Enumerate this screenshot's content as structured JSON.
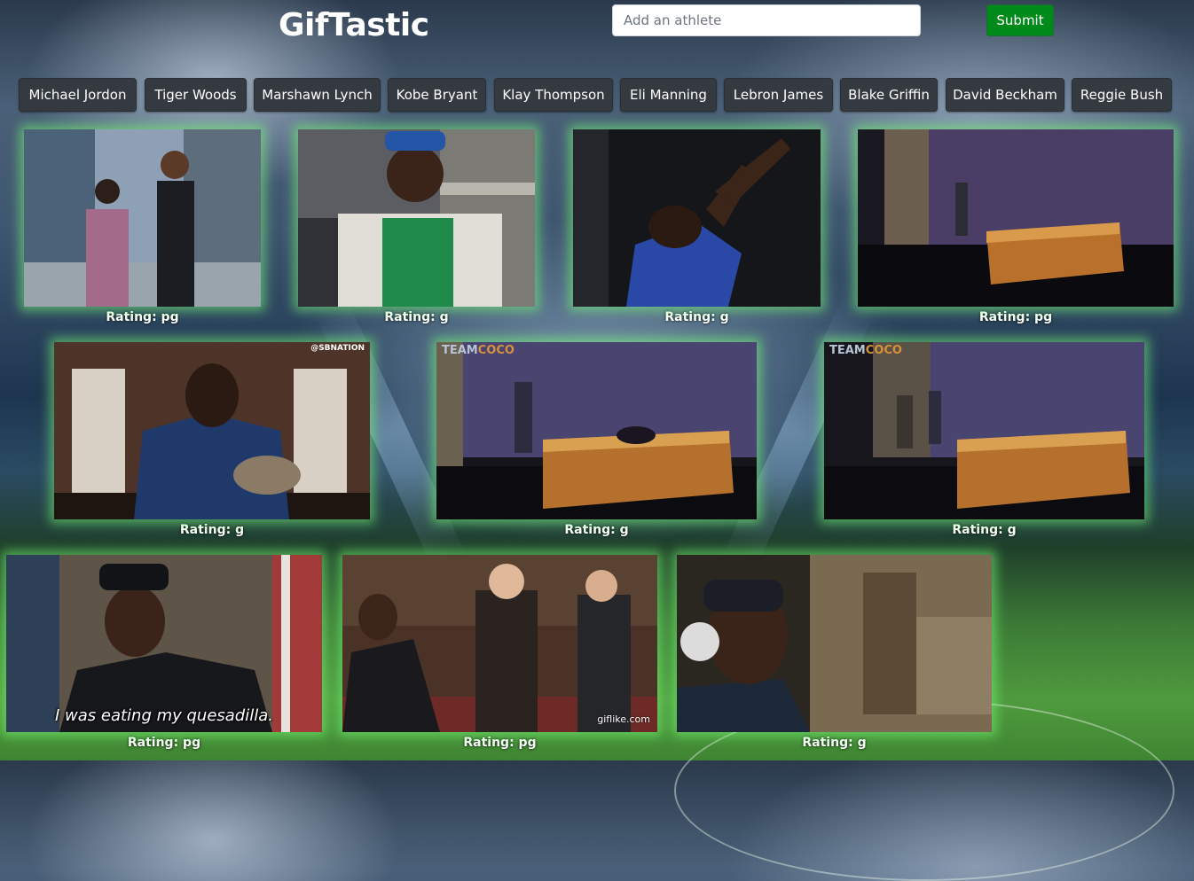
{
  "header": {
    "title": "GifTastic",
    "input_placeholder": "Add an athlete",
    "input_value": "",
    "submit_label": "Submit"
  },
  "athletes": [
    "Michael Jordon",
    "Tiger Woods",
    "Marshawn Lynch",
    "Kobe Bryant",
    "Klay Thompson",
    "Eli Manning",
    "Lebron James",
    "Blake Griffin",
    "David Beckham",
    "Reggie Bush"
  ],
  "gifs": [
    {
      "rating": "Rating: pg"
    },
    {
      "rating": "Rating: g"
    },
    {
      "rating": "Rating: g"
    },
    {
      "rating": "Rating: pg"
    },
    {
      "rating": "Rating: g",
      "logo": "@SBNATION"
    },
    {
      "rating": "Rating: g",
      "logo_a": "TEAM",
      "logo_b": "COCO"
    },
    {
      "rating": "Rating: g",
      "logo_a": "TEAM",
      "logo_b": "COCO"
    },
    {
      "rating": "Rating: pg",
      "caption": "I was eating my quesadilla."
    },
    {
      "rating": "Rating: pg",
      "watermark": "giflike.com"
    },
    {
      "rating": "Rating: g"
    }
  ],
  "colors": {
    "submit": "#008a1a",
    "athlete_button": "#343a40",
    "gif_glow": "#78ff78"
  }
}
